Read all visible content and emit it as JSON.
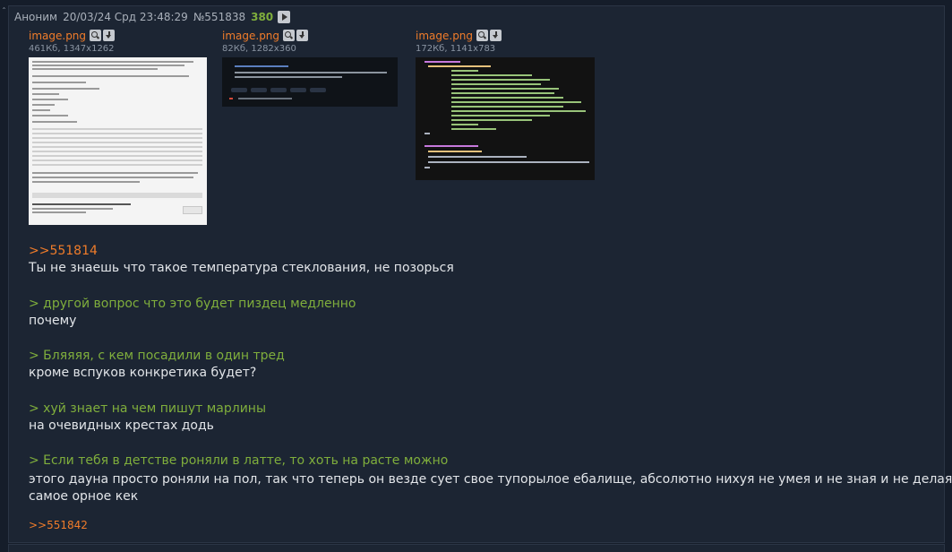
{
  "post": {
    "corner_mark": "ˆ",
    "author": "Аноним",
    "date": "20/03/24 Срд 23:48:29",
    "number": "№551838",
    "position_count": "380",
    "play_icon": "play-icon"
  },
  "files": [
    {
      "name": "image.png",
      "meta": "461Кб, 1347x1262",
      "icons": [
        "search-icon",
        "download-icon"
      ]
    },
    {
      "name": "image.png",
      "meta": "82Кб, 1282x360",
      "icons": [
        "search-icon",
        "download-icon"
      ]
    },
    {
      "name": "image.png",
      "meta": "172Кб, 1141x783",
      "icons": [
        "search-icon",
        "download-icon"
      ]
    }
  ],
  "body": {
    "reply_link": ">>551814",
    "line1": "Ты не знаешь что такое температура стеклования, не позорься",
    "quote1": "> другой вопрос что это будет пиздец медленно",
    "line2": "почему",
    "quote2": "> Бляяяя, с кем посадили в один тред",
    "line3": "кроме вспуков конкретика будет?",
    "quote3": "> хуй знает на чем пишут марлины",
    "line4": "на очевидных крестах додь",
    "quote4": "> Если тебя в детстве роняли в латте, то хоть на расте можно",
    "line5a": "этого дауна просто роняли на пол, так что теперь он везде сует свое тупорылое ебалище, абсолютно нихуя не умея и не зная и не делая что",
    "line5b": "самое орное кек",
    "backlink": ">>551842"
  },
  "colors": {
    "background": "#151d2a",
    "post_bg": "#1c2533",
    "link": "#f07c2a",
    "quote": "#7fae3c",
    "text": "#e2e5e9",
    "muted": "#a9b0ba"
  }
}
